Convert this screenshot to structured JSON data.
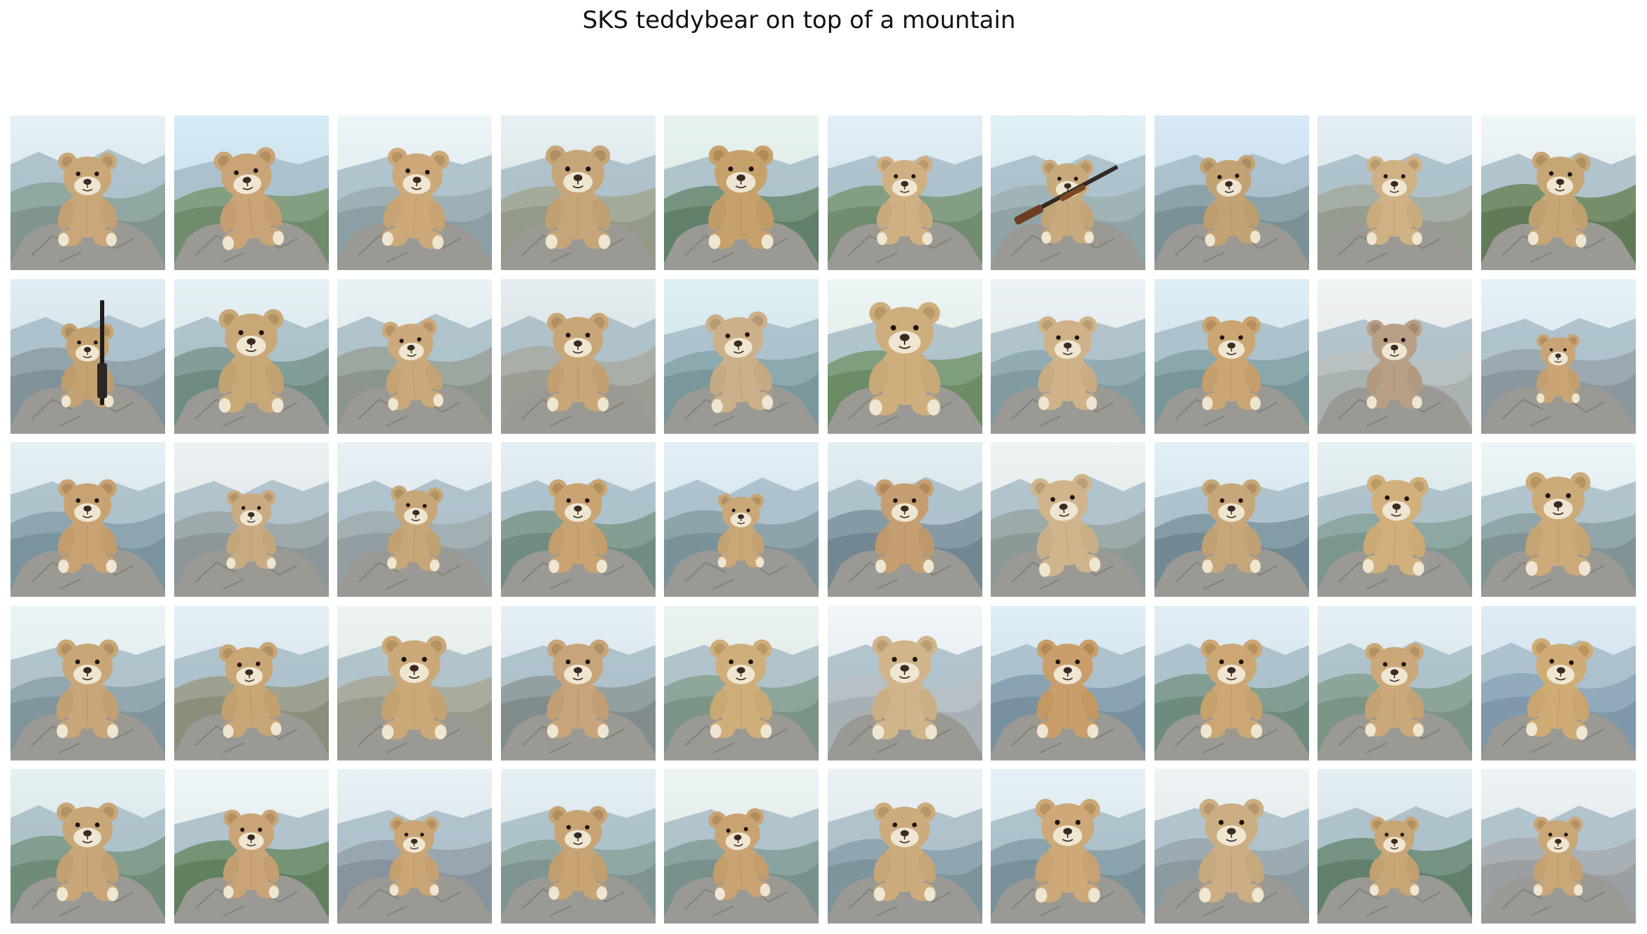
{
  "title": "SKS teddybear on top of a mountain",
  "grid": {
    "rows": 5,
    "columns": 10,
    "image_subject": "teddy bear sitting on a rock on top of a mountain"
  },
  "colors": {
    "sky": "#dbe8ec",
    "far_mountains": "#9fb6c2",
    "mid_mountains": "#7f9a8a",
    "rock": "#9a9994",
    "fur": "#c9a774",
    "muzzle": "#efe6d2",
    "nose": "#3a2a22"
  },
  "variants": [
    {
      "fur": "#caa778",
      "sky": "#dde9ee",
      "hill": "#8ea49c",
      "scale": 0.95,
      "tilt": 0,
      "rifle": "none"
    },
    {
      "fur": "#c8a476",
      "sky": "#cfe3ee",
      "hill": "#7f9a7a",
      "scale": 1.0,
      "tilt": -6,
      "rifle": "none"
    },
    {
      "fur": "#cda97a",
      "sky": "#e4eef1",
      "hill": "#9aaeb4",
      "scale": 1.0,
      "tilt": 4,
      "rifle": "none"
    },
    {
      "fur": "#c6a679",
      "sky": "#dfe8ea",
      "hill": "#a2a996",
      "scale": 1.05,
      "tilt": 0,
      "rifle": "none"
    },
    {
      "fur": "#c7a16b",
      "sky": "#e1ece9",
      "hill": "#6f8f78",
      "scale": 1.05,
      "tilt": 0,
      "rifle": "none"
    },
    {
      "fur": "#cfb082",
      "sky": "#d9e7f1",
      "hill": "#7f9a7c",
      "scale": 0.9,
      "tilt": 0,
      "rifle": "none"
    },
    {
      "fur": "#c9aa7c",
      "sky": "#d7e8ee",
      "hill": "#9fb2b5",
      "scale": 0.85,
      "tilt": 0,
      "rifle": "horizontal"
    },
    {
      "fur": "#c3a273",
      "sky": "#cfe1ee",
      "hill": "#8aa0a6",
      "scale": 0.9,
      "tilt": -4,
      "rifle": "none"
    },
    {
      "fur": "#d0b184",
      "sky": "#dbe7ec",
      "hill": "#a4aca0",
      "scale": 0.9,
      "tilt": 0,
      "rifle": "none"
    },
    {
      "fur": "#c7a676",
      "sky": "#e6eef0",
      "hill": "#6f8a63",
      "scale": 0.95,
      "tilt": 3,
      "rifle": "none"
    },
    {
      "fur": "#c5a272",
      "sky": "#d8e6ec",
      "hill": "#8ea1a8",
      "scale": 0.85,
      "tilt": 0,
      "rifle": "vertical"
    },
    {
      "fur": "#c9a878",
      "sky": "#dde9ec",
      "hill": "#7e9a92",
      "scale": 1.05,
      "tilt": 0,
      "rifle": "none"
    },
    {
      "fur": "#cba97a",
      "sky": "#e1ebee",
      "hill": "#9aa49a",
      "scale": 0.9,
      "tilt": -5,
      "rifle": "none"
    },
    {
      "fur": "#c8a677",
      "sky": "#dde5e8",
      "hill": "#a9aca3",
      "scale": 1.0,
      "tilt": 0,
      "rifle": "none"
    },
    {
      "fur": "#cbb089",
      "sky": "#d6e8ec",
      "hill": "#8aa6ad",
      "scale": 1.0,
      "tilt": -4,
      "rifle": "none"
    },
    {
      "fur": "#cfae7d",
      "sky": "#e5eeea",
      "hill": "#7a9a74",
      "scale": 1.15,
      "tilt": 0,
      "rifle": "none"
    },
    {
      "fur": "#cfb288",
      "sky": "#e4ebee",
      "hill": "#8eaab0",
      "scale": 0.95,
      "tilt": 0,
      "rifle": "none"
    },
    {
      "fur": "#cba572",
      "sky": "#d6e6ee",
      "hill": "#86a4a8",
      "scale": 0.95,
      "tilt": 0,
      "rifle": "none"
    },
    {
      "fur": "#b89f86",
      "sky": "#e9ecec",
      "hill": "#b9c0c0",
      "scale": 0.9,
      "tilt": 0,
      "rifle": "none"
    },
    {
      "fur": "#c9a576",
      "sky": "#dfeaf0",
      "hill": "#9aa6ae",
      "scale": 0.7,
      "tilt": 0,
      "rifle": "none"
    },
    {
      "fur": "#c8a272",
      "sky": "#dce8ec",
      "hill": "#88a2ae",
      "scale": 0.95,
      "tilt": 0,
      "rifle": "none"
    },
    {
      "fur": "#c9ab82",
      "sky": "#e4eaec",
      "hill": "#9ca6a8",
      "scale": 0.8,
      "tilt": 0,
      "rifle": "none"
    },
    {
      "fur": "#c7a777",
      "sky": "#dfe9ee",
      "hill": "#a1adb0",
      "scale": 0.85,
      "tilt": 3,
      "rifle": "none"
    },
    {
      "fur": "#c9a371",
      "sky": "#dbe7ec",
      "hill": "#7f9a8e",
      "scale": 0.95,
      "tilt": 0,
      "rifle": "none"
    },
    {
      "fur": "#c9a776",
      "sky": "#d9e7ef",
      "hill": "#8aa1a9",
      "scale": 0.75,
      "tilt": 0,
      "rifle": "none"
    },
    {
      "fur": "#c59f72",
      "sky": "#dbe6eb",
      "hill": "#8196a0",
      "scale": 0.95,
      "tilt": 0,
      "rifle": "none"
    },
    {
      "fur": "#d0b58c",
      "sky": "#e6ecec",
      "hill": "#9aa8a6",
      "scale": 1.0,
      "tilt": -6,
      "rifle": "none"
    },
    {
      "fur": "#c7a67a",
      "sky": "#d9e8ee",
      "hill": "#7f98a2",
      "scale": 0.95,
      "tilt": 0,
      "rifle": "none"
    },
    {
      "fur": "#d1b07c",
      "sky": "#dde8ea",
      "hill": "#8aa49e",
      "scale": 1.0,
      "tilt": 3,
      "rifle": "none"
    },
    {
      "fur": "#ccaa79",
      "sky": "#e4eef0",
      "hill": "#8ea3a4",
      "scale": 1.05,
      "tilt": 0,
      "rifle": "none"
    },
    {
      "fur": "#c9a677",
      "sky": "#e3ecee",
      "hill": "#8fa4ac",
      "scale": 1.0,
      "tilt": 0,
      "rifle": "none"
    },
    {
      "fur": "#c9a676",
      "sky": "#dce8ee",
      "hill": "#9a9d8a",
      "scale": 0.95,
      "tilt": -3,
      "rifle": "none"
    },
    {
      "fur": "#cba878",
      "sky": "#e5ecea",
      "hill": "#a7aa9a",
      "scale": 1.05,
      "tilt": 0,
      "rifle": "none"
    },
    {
      "fur": "#c8a47a",
      "sky": "#dde8ee",
      "hill": "#909c9c",
      "scale": 1.0,
      "tilt": 0,
      "rifle": "none"
    },
    {
      "fur": "#cfae7a",
      "sky": "#e4ecea",
      "hill": "#8ba294",
      "scale": 1.0,
      "tilt": 0,
      "rifle": "none"
    },
    {
      "fur": "#d0b48a",
      "sky": "#e8eef2",
      "hill": "#b7c0c4",
      "scale": 1.05,
      "tilt": 0,
      "rifle": "none"
    },
    {
      "fur": "#c99e6b",
      "sky": "#d6e6ee",
      "hill": "#86a0b0",
      "scale": 1.0,
      "tilt": 0,
      "rifle": "none"
    },
    {
      "fur": "#cba773",
      "sky": "#d9e6ee",
      "hill": "#7d9a8c",
      "scale": 1.0,
      "tilt": 0,
      "rifle": "none"
    },
    {
      "fur": "#caa879",
      "sky": "#dce8ec",
      "hill": "#8aa294",
      "scale": 0.95,
      "tilt": 0,
      "rifle": "none"
    },
    {
      "fur": "#cfab76",
      "sky": "#d5e4ef",
      "hill": "#8ea7ba",
      "scale": 1.0,
      "tilt": 4,
      "rifle": "none"
    },
    {
      "fur": "#c9a677",
      "sky": "#dde8ea",
      "hill": "#7e9a88",
      "scale": 1.0,
      "tilt": 0,
      "rifle": "none"
    },
    {
      "fur": "#c8a476",
      "sky": "#e6eef0",
      "hill": "#6f8e6c",
      "scale": 0.9,
      "tilt": 0,
      "rifle": "none"
    },
    {
      "fur": "#caa676",
      "sky": "#dfe9ee",
      "hill": "#96a3ae",
      "scale": 0.8,
      "tilt": 0,
      "rifle": "none"
    },
    {
      "fur": "#c8a474",
      "sky": "#dce8ec",
      "hill": "#8ea4a0",
      "scale": 0.95,
      "tilt": 0,
      "rifle": "none"
    },
    {
      "fur": "#c9a372",
      "sky": "#e4ecec",
      "hill": "#86a09c",
      "scale": 0.9,
      "tilt": -5,
      "rifle": "none"
    },
    {
      "fur": "#ccab7d",
      "sky": "#e2eaee",
      "hill": "#8ca2ac",
      "scale": 1.0,
      "tilt": 0,
      "rifle": "none"
    },
    {
      "fur": "#cda878",
      "sky": "#dde9ee",
      "hill": "#86a0a8",
      "scale": 1.05,
      "tilt": 0,
      "rifle": "none"
    },
    {
      "fur": "#ccae84",
      "sky": "#e6eced",
      "hill": "#9aa9ae",
      "scale": 1.05,
      "tilt": 0,
      "rifle": "none"
    },
    {
      "fur": "#c9a676",
      "sky": "#dbe6ea",
      "hill": "#6f8e7a",
      "scale": 0.8,
      "tilt": 0,
      "rifle": "none"
    },
    {
      "fur": "#caa777",
      "sky": "#e6ebee",
      "hill": "#a8aeb2",
      "scale": 0.8,
      "tilt": 0,
      "rifle": "none"
    }
  ]
}
